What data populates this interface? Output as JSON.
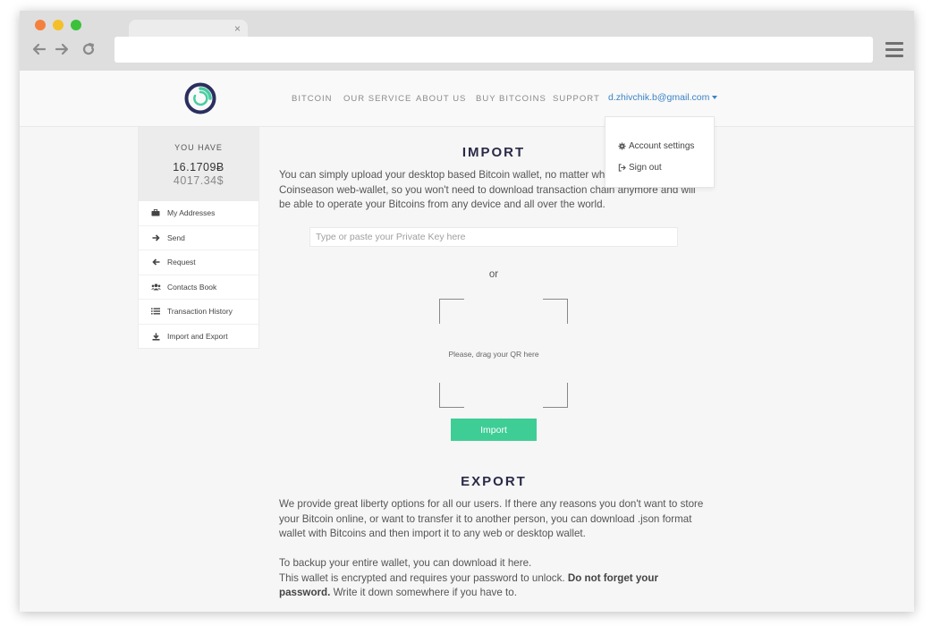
{
  "browser": {
    "tab_close": "×",
    "address": ""
  },
  "nav": {
    "items": [
      "BITCOIN",
      "OUR SERVICE",
      "ABOUT US",
      "BUY BITCOINS",
      "SUPPORT"
    ],
    "user_email": "d.zhivchik.b@gmail.com"
  },
  "dropdown": {
    "items": [
      {
        "label": "Account settings",
        "icon": "gear-icon"
      },
      {
        "label": "Sign out",
        "icon": "sign-out-icon"
      }
    ]
  },
  "balance": {
    "label": "YOU HAVE",
    "btc": "16.1709Ƀ",
    "usd": "4017.34$"
  },
  "sidebar": {
    "items": [
      {
        "label": "My Addresses",
        "icon": "briefcase-icon"
      },
      {
        "label": "Send",
        "icon": "arrow-right-icon"
      },
      {
        "label": "Request",
        "icon": "arrow-left-icon"
      },
      {
        "label": "Contacts Book",
        "icon": "users-icon"
      },
      {
        "label": "Transaction History",
        "icon": "list-icon"
      },
      {
        "label": "Import and Export",
        "icon": "download-icon"
      }
    ]
  },
  "import": {
    "title": "IMPORT",
    "description": "You can simply upload your desktop based Bitcoin wallet, no matter which you used, to our Coinseason web-wallet, so you won't need to download transaction chain anymore and will be able to operate your Bitcoins from any device and all over the world.",
    "input_placeholder": "Type or paste your Private Key here",
    "or": "or",
    "qr_text": "Please, drag your QR here",
    "button": "Import"
  },
  "export": {
    "title": "EXPORT",
    "paragraph1": "We provide great liberty options for all our users. If there any reasons you don't want to store your Bitcoin online, or want to transfer it to another person, you can download .json format wallet with Bitcoins and then import it to any web or desktop wallet.",
    "p2_line1": "To backup your entire wallet, you can download it here.",
    "p2_line2": "This wallet is encrypted and requires your password to unlock. ",
    "p2_bold": "Do not forget your password.",
    "p2_end": " Write it down somewhere if you have to."
  },
  "colors": {
    "accent_green": "#3fcd96",
    "link_blue": "#3b83c4",
    "heading": "#2a2a48"
  }
}
